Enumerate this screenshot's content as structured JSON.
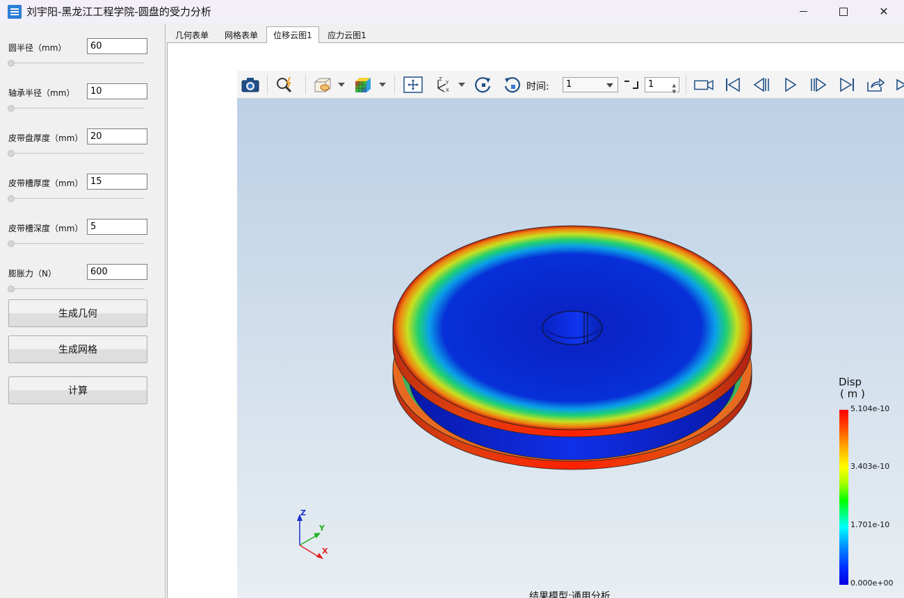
{
  "window": {
    "title": "刘宇阳-黑龙江工程学院-圆盘的受力分析",
    "minimize_glyph": "—",
    "close_glyph": "✕"
  },
  "params": [
    {
      "label": "圆半径（mm）",
      "value": "60"
    },
    {
      "label": "轴承半径（mm）",
      "value": "10"
    },
    {
      "label": "皮带盘厚度（mm）",
      "value": "20"
    },
    {
      "label": "皮带槽厚度（mm）",
      "value": "15"
    },
    {
      "label": "皮带槽深度（mm）",
      "value": "5"
    },
    {
      "label": "膨胀力（N）",
      "value": "600"
    }
  ],
  "buttons": {
    "generate_geometry": "生成几何",
    "generate_mesh": "生成网格",
    "compute": "计算"
  },
  "tabs": [
    {
      "label": "几何表单",
      "active": false
    },
    {
      "label": "网格表单",
      "active": false
    },
    {
      "label": "位移云图1",
      "active": true
    },
    {
      "label": "应力云图1",
      "active": false
    }
  ],
  "toolbar": {
    "time_label": "时间:",
    "time_value": "1",
    "step_value": "1"
  },
  "legend": {
    "title_line1": "Disp",
    "title_line2": "( m )",
    "max": "5.104e-10",
    "v2": "3.403e-10",
    "v3": "1.701e-10",
    "min": "0.000e+00"
  },
  "axes": {
    "z": "Z",
    "y": "Y",
    "x": "X"
  },
  "footer": "结果模型:通用分析",
  "colors": {
    "accent": "#2d7fd6",
    "viewport_top": "#bcd0e6",
    "viewport_bottom": "#e8eef2"
  }
}
